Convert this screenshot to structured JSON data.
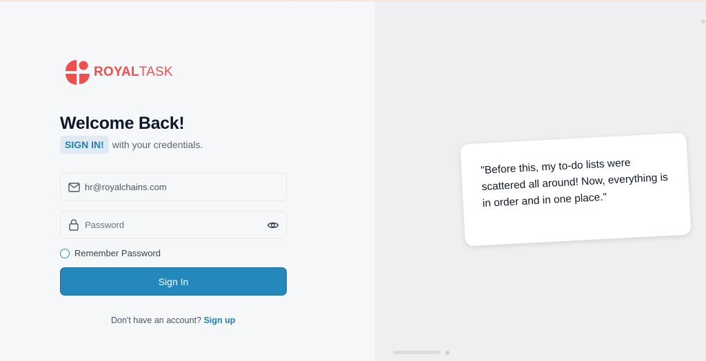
{
  "brand": {
    "name_bold": "ROYAL",
    "name_light": "TASK",
    "color": "#ef4e4f"
  },
  "login": {
    "title": "Welcome Back!",
    "signin_chip": "SIGN IN!",
    "subtitle_rest": "with your credentials.",
    "email": {
      "value": "hr@royalchains.com",
      "icon": "mail-icon"
    },
    "password": {
      "placeholder": "Password",
      "value": "",
      "icon": "lock-icon",
      "toggle_icon": "eye-icon"
    },
    "remember_label": "Remember Password",
    "submit_label": "Sign In",
    "signup_prompt": "Don't have an account?",
    "signup_link": "Sign up",
    "accent": "#2588bd"
  },
  "testimonial": {
    "quote": "\"Before this, my to-do lists were scattered all around! Now, everything is in order and in one place.\""
  }
}
